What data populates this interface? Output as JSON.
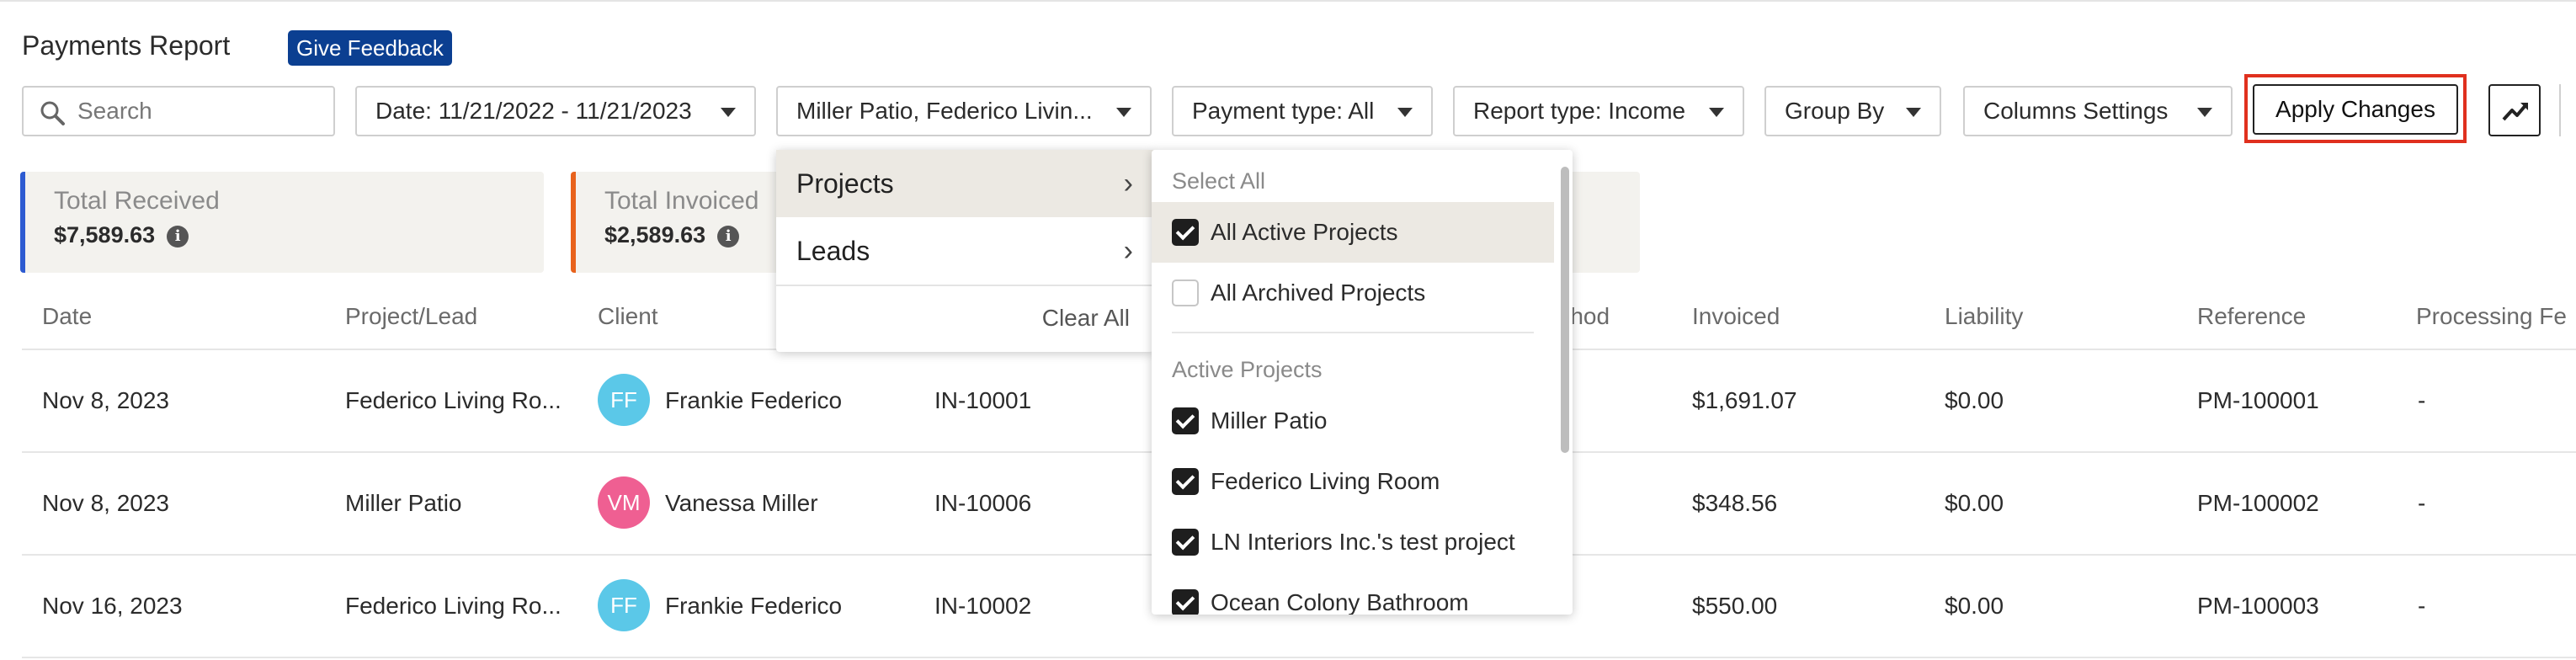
{
  "header": {
    "title": "Payments Report",
    "feedback": "Give Feedback"
  },
  "toolbar": {
    "search_placeholder": "Search",
    "date": "Date: 11/21/2022 - 11/21/2023",
    "projects_filter": "Miller Patio, Federico Livin...",
    "payment_type": "Payment type: All",
    "report_type": "Report type: Income",
    "group_by": "Group By",
    "columns_settings": "Columns Settings",
    "apply": "Apply Changes",
    "chart_icon": "trending-up-icon"
  },
  "summary": [
    {
      "label": "Total Received",
      "value": "$7,589.63",
      "color": "#2d5bd1"
    },
    {
      "label": "Total Invoiced",
      "value": "$2,589.63",
      "color": "#e8621c"
    }
  ],
  "table": {
    "columns": [
      "Date",
      "Project/Lead",
      "Client",
      "ethod",
      "Invoiced",
      "Liability",
      "Reference",
      "Processing Fe"
    ],
    "rows": [
      {
        "date": "Nov 8, 2023",
        "project": "Federico Living Ro...",
        "initials": "FF",
        "avatar_color": "#5bc8e8",
        "client": "Frankie Federico",
        "invoice": "IN-10001",
        "invoiced": "$1,691.07",
        "liability": "$0.00",
        "reference": "PM-100001",
        "fee": "-"
      },
      {
        "date": "Nov 8, 2023",
        "project": "Miller Patio",
        "initials": "VM",
        "avatar_color": "#ef5f92",
        "client": "Vanessa Miller",
        "invoice": "IN-10006",
        "invoiced": "$348.56",
        "liability": "$0.00",
        "reference": "PM-100002",
        "fee": "-"
      },
      {
        "date": "Nov 16, 2023",
        "project": "Federico Living Ro...",
        "initials": "FF",
        "avatar_color": "#5bc8e8",
        "client": "Frankie Federico",
        "invoice": "IN-10002",
        "invoiced": "$550.00",
        "liability": "$0.00",
        "reference": "PM-100003",
        "fee": "-"
      }
    ]
  },
  "filter_menu": {
    "items": [
      {
        "label": "Projects",
        "selected": true
      },
      {
        "label": "Leads",
        "selected": false
      }
    ],
    "clear_all": "Clear All"
  },
  "project_panel": {
    "select_all_heading": "Select All",
    "all_active": {
      "label": "All Active Projects",
      "checked": true
    },
    "all_archived": {
      "label": "All Archived Projects",
      "checked": false
    },
    "active_heading": "Active Projects",
    "projects": [
      {
        "label": "Miller Patio",
        "checked": true
      },
      {
        "label": "Federico Living Room",
        "checked": true
      },
      {
        "label": "LN Interiors Inc.'s test project",
        "checked": true
      },
      {
        "label": "Ocean Colony Bathroom",
        "checked": true
      }
    ]
  }
}
